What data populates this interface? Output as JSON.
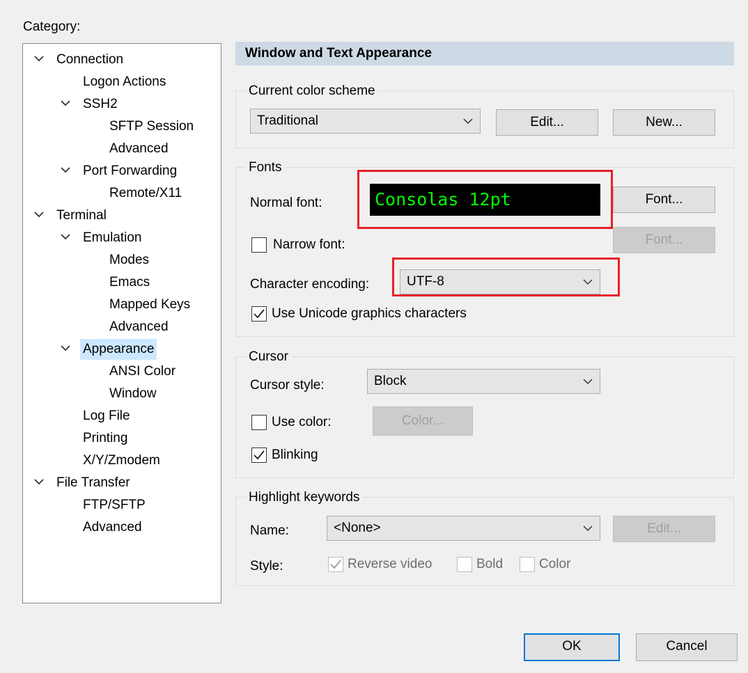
{
  "category_label": "Category:",
  "tree": [
    {
      "label": "Connection",
      "expanded": true,
      "level": 0
    },
    {
      "label": "Logon Actions",
      "level": 1
    },
    {
      "label": "SSH2",
      "expanded": true,
      "level": 1
    },
    {
      "label": "SFTP Session",
      "level": 2
    },
    {
      "label": "Advanced",
      "level": 2
    },
    {
      "label": "Port Forwarding",
      "expanded": true,
      "level": 1
    },
    {
      "label": "Remote/X11",
      "level": 2
    },
    {
      "label": "Terminal",
      "expanded": true,
      "level": 0
    },
    {
      "label": "Emulation",
      "expanded": true,
      "level": 1
    },
    {
      "label": "Modes",
      "level": 2
    },
    {
      "label": "Emacs",
      "level": 2
    },
    {
      "label": "Mapped Keys",
      "level": 2
    },
    {
      "label": "Advanced",
      "level": 2
    },
    {
      "label": "Appearance",
      "expanded": true,
      "level": 1,
      "selected": true
    },
    {
      "label": "ANSI Color",
      "level": 2
    },
    {
      "label": "Window",
      "level": 2
    },
    {
      "label": "Log File",
      "level": 1
    },
    {
      "label": "Printing",
      "level": 1
    },
    {
      "label": "X/Y/Zmodem",
      "level": 1
    },
    {
      "label": "File Transfer",
      "expanded": true,
      "level": 0
    },
    {
      "label": "FTP/SFTP",
      "level": 1
    },
    {
      "label": "Advanced",
      "level": 1
    }
  ],
  "header": "Window and Text Appearance",
  "color_scheme": {
    "title": "Current color scheme",
    "value": "Traditional",
    "edit_label": "Edit...",
    "new_label": "New..."
  },
  "fonts": {
    "title": "Fonts",
    "normal_font_label": "Normal font:",
    "preview_text": "Consolas 12pt",
    "font_button": "Font...",
    "narrow_font_label": "Narrow font:",
    "narrow_font_checked": false,
    "narrow_font_button": "Font...",
    "encoding_label": "Character encoding:",
    "encoding_value": "UTF-8",
    "unicode_label": "Use Unicode graphics characters",
    "unicode_checked": true
  },
  "cursor": {
    "title": "Cursor",
    "style_label": "Cursor style:",
    "style_value": "Block",
    "use_color_label": "Use color:",
    "use_color_checked": false,
    "color_button": "Color...",
    "blinking_label": "Blinking",
    "blinking_checked": true
  },
  "highlight": {
    "title": "Highlight keywords",
    "name_label": "Name:",
    "name_value": "<None>",
    "edit_button": "Edit...",
    "style_label": "Style:",
    "reverse_label": "Reverse video",
    "reverse_checked": true,
    "bold_label": "Bold",
    "bold_checked": false,
    "color_label": "Color",
    "color_checked": false
  },
  "footer": {
    "ok_label": "OK",
    "cancel_label": "Cancel"
  },
  "colors": {
    "highlight_box": "#e8202a",
    "preview_fg": "#00ff00",
    "preview_bg": "#000000",
    "selected_bg": "#cce8ff",
    "header_bg": "#cdd9e5"
  }
}
